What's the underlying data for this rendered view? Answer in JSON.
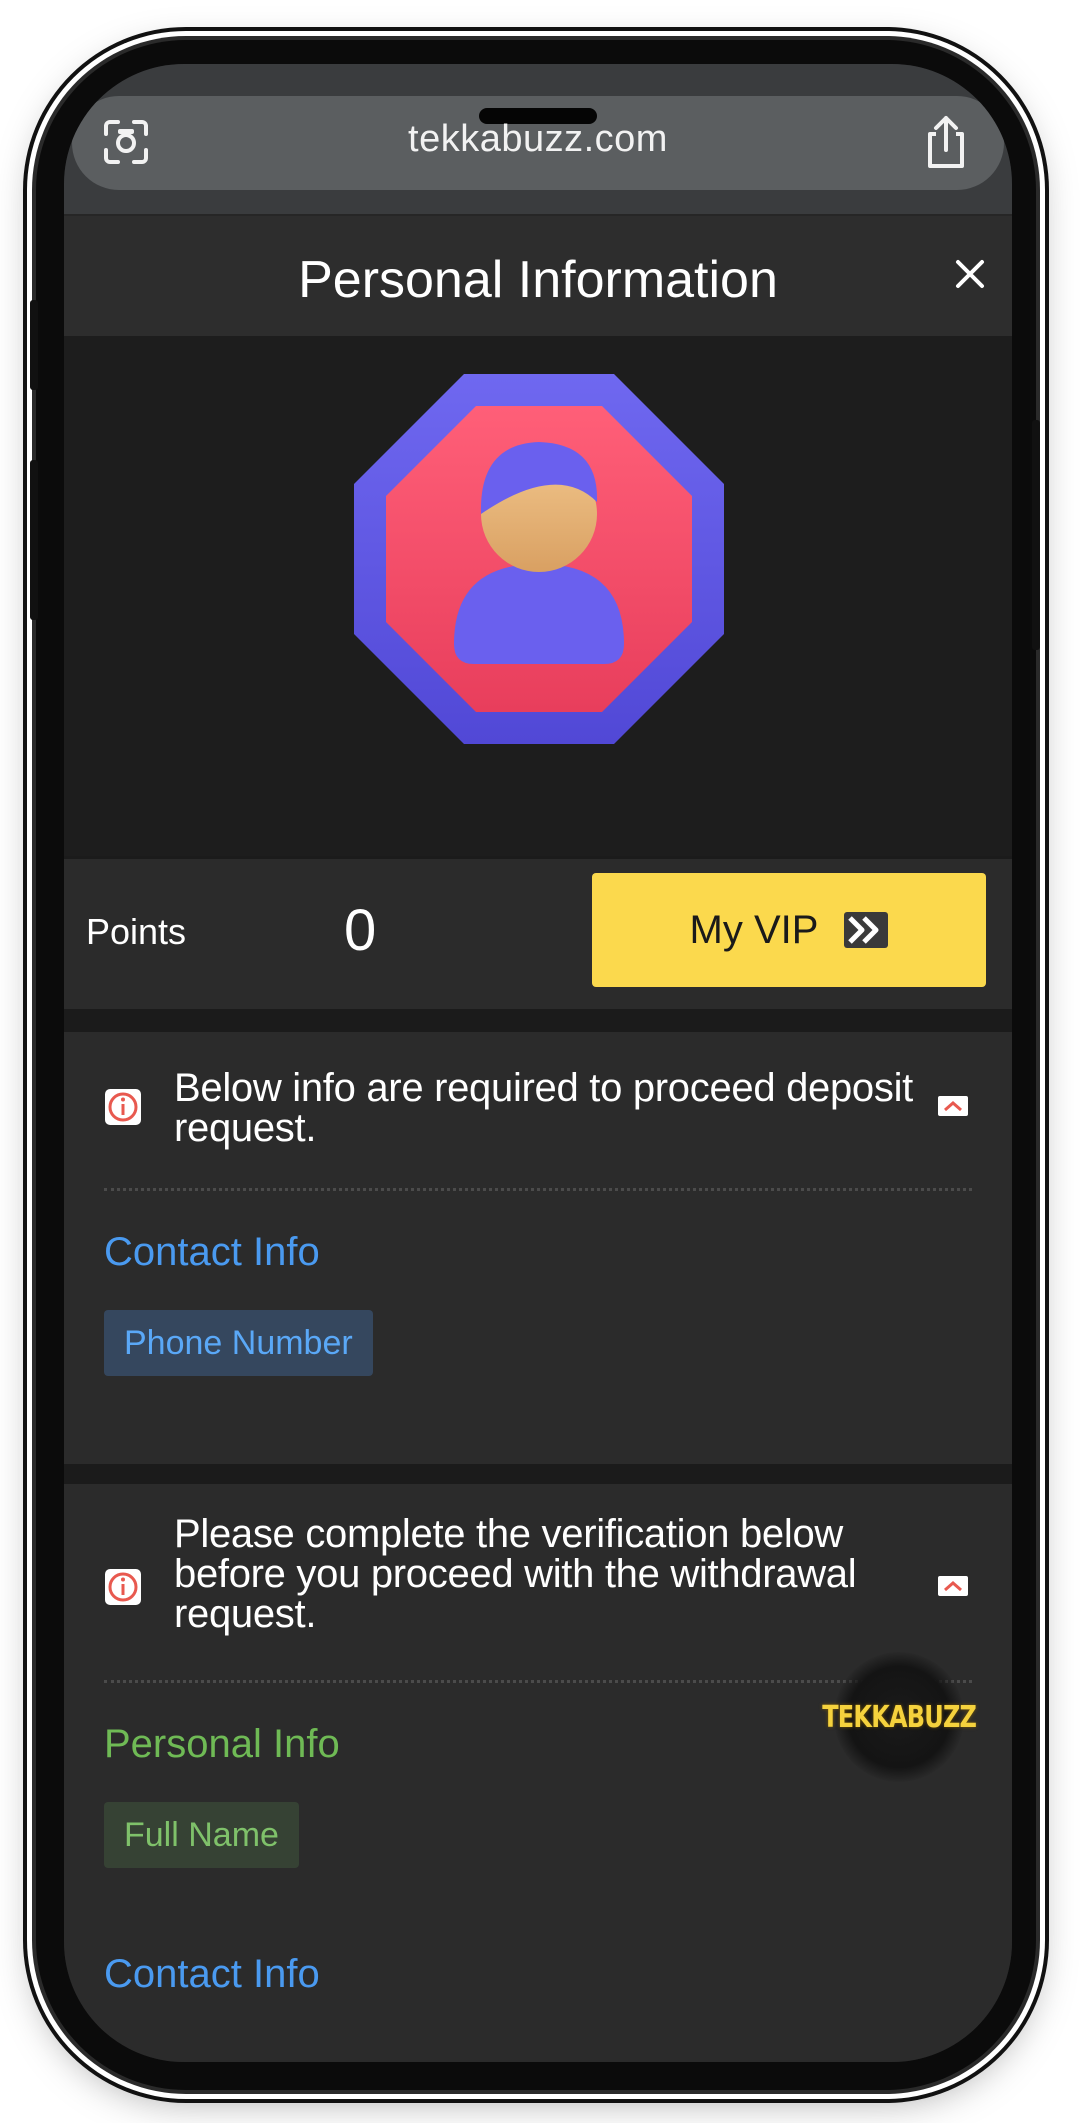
{
  "browser": {
    "url": "tekkabuzz.com",
    "scan_icon": "scan-icon",
    "share_icon": "share-icon"
  },
  "header": {
    "title": "Personal Information",
    "close_icon": "close-icon"
  },
  "profile": {
    "avatar": "user-avatar-octagon"
  },
  "points": {
    "label": "Points",
    "value": "0",
    "vip_button_label": "My VIP",
    "vip_icon": "double-chevron-right-icon"
  },
  "deposit_notice": {
    "text": "Below info are required to proceed deposit request.",
    "info_icon": "info-icon",
    "collapse_icon": "chevron-up-icon",
    "sections": [
      {
        "title": "Contact Info",
        "tags": [
          "Phone Number"
        ]
      }
    ]
  },
  "withdrawal_notice": {
    "text": "Please complete the verification below before you proceed with the withdrawal request.",
    "info_icon": "info-icon",
    "collapse_icon": "chevron-up-icon",
    "sections": [
      {
        "title": "Personal Info",
        "tags": [
          "Full Name"
        ]
      },
      {
        "title": "Contact Info",
        "tags": []
      }
    ]
  },
  "floating_logo": {
    "text": "TEKKABUZZ"
  },
  "colors": {
    "accent_yellow": "#fbd94d",
    "contact_blue": "#4a9af0",
    "personal_green": "#6fba55",
    "warning_red": "#e8594f"
  }
}
